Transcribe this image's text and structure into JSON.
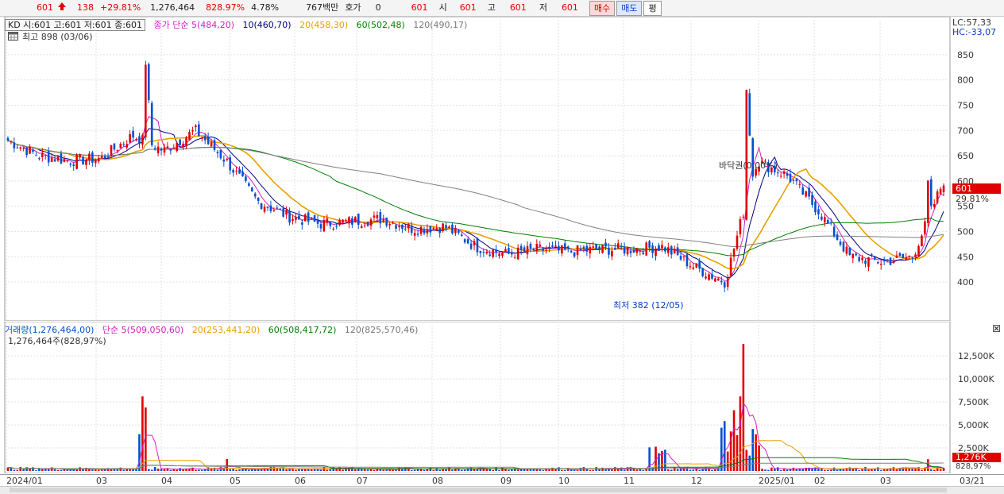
{
  "topbar": {
    "price": "601",
    "change": "138",
    "change_pct": "+29.81%",
    "volume": "1,276,464",
    "volume_ratio": "828.97%",
    "turnover": "4.78%",
    "amount": "767백만",
    "quote_label": "호가",
    "quote_value": "0",
    "quote_price": "601",
    "open_label": "시",
    "open": "601",
    "high_label": "고",
    "high": "601",
    "low_label": "저",
    "low": "601",
    "buy_label": "매수",
    "sell_label": "매도",
    "avg_label": "평"
  },
  "price_pane": {
    "ohlc_box": "KD 시:601 고:601 저:601 종:601",
    "ma_title": "종가 단순 5(484,20)",
    "ma10": "10(460,70)",
    "ma20": "20(458,30)",
    "ma60": "60(502,48)",
    "ma120": "120(490,17)",
    "lc": "LC:57,33",
    "hc": "HC:-33,07",
    "high_note": "최고 898 (03/06)",
    "low_note": "최저 382 (12/05)",
    "event_note": "바닥권(0.00%)",
    "current_price": "601",
    "current_pct": "29.81%",
    "y_ticks": [
      "850",
      "800",
      "750",
      "700",
      "650",
      "600",
      "550",
      "500",
      "450",
      "400"
    ]
  },
  "volume_pane": {
    "title": "거래량(1,276,464,00)",
    "ma5": "단순 5(509,050,60)",
    "ma20": "20(253,441,20)",
    "ma60": "60(508,417,72)",
    "ma120": "120(825,570,46)",
    "subtitle": "1,276,464주(828,97%)",
    "current_volume": "1,276K",
    "current_pct": "828,97%",
    "y_ticks": [
      "12,500K",
      "10,000K",
      "7,500K",
      "5,000K",
      "2,500K"
    ]
  },
  "x_axis": {
    "labels": [
      "2024/01",
      "03",
      "04",
      "05",
      "06",
      "07",
      "08",
      "09",
      "10",
      "11",
      "12",
      "2025/01",
      "02",
      "03"
    ],
    "last_date": "03/21"
  },
  "colors": {
    "up": "#e00000",
    "down": "#0050d0",
    "ma5": "#d020c0",
    "ma10": "#000080",
    "ma20": "#e8a000",
    "ma60": "#008000",
    "ma120": "#808080"
  },
  "chart_data": {
    "type": "candlestick",
    "x_range": [
      "2024/01",
      "2025/03"
    ],
    "price_ylim": [
      350,
      900
    ],
    "volume_ylim": [
      0,
      14500
    ],
    "close_points": [
      [
        "2024/01",
        680
      ],
      [
        "2024/01b",
        650
      ],
      [
        "2024/02",
        640
      ],
      [
        "2024/02b",
        645
      ],
      [
        "2024/03",
        690
      ],
      [
        "2024/03b",
        660
      ],
      [
        "2024/03c",
        700
      ],
      [
        "2024/04",
        640
      ],
      [
        "2024/04b",
        560
      ],
      [
        "2024/05",
        530
      ],
      [
        "2024/05b",
        515
      ],
      [
        "2024/06",
        520
      ],
      [
        "2024/06b",
        525
      ],
      [
        "2024/07",
        505
      ],
      [
        "2024/07b",
        510
      ],
      [
        "2024/08",
        470
      ],
      [
        "2024/08b",
        455
      ],
      [
        "2024/09",
        465
      ],
      [
        "2024/09b",
        460
      ],
      [
        "2024/10",
        465
      ],
      [
        "2024/10b",
        465
      ],
      [
        "2024/11",
        470
      ],
      [
        "2024/11b",
        430
      ],
      [
        "2024/12",
        400
      ],
      [
        "2024/12b",
        640
      ],
      [
        "2025/01",
        610
      ],
      [
        "2025/01b",
        540
      ],
      [
        "2025/02",
        450
      ],
      [
        "2025/02b",
        440
      ],
      [
        "2025/03",
        450
      ],
      [
        "2025/03b",
        601
      ]
    ]
  }
}
